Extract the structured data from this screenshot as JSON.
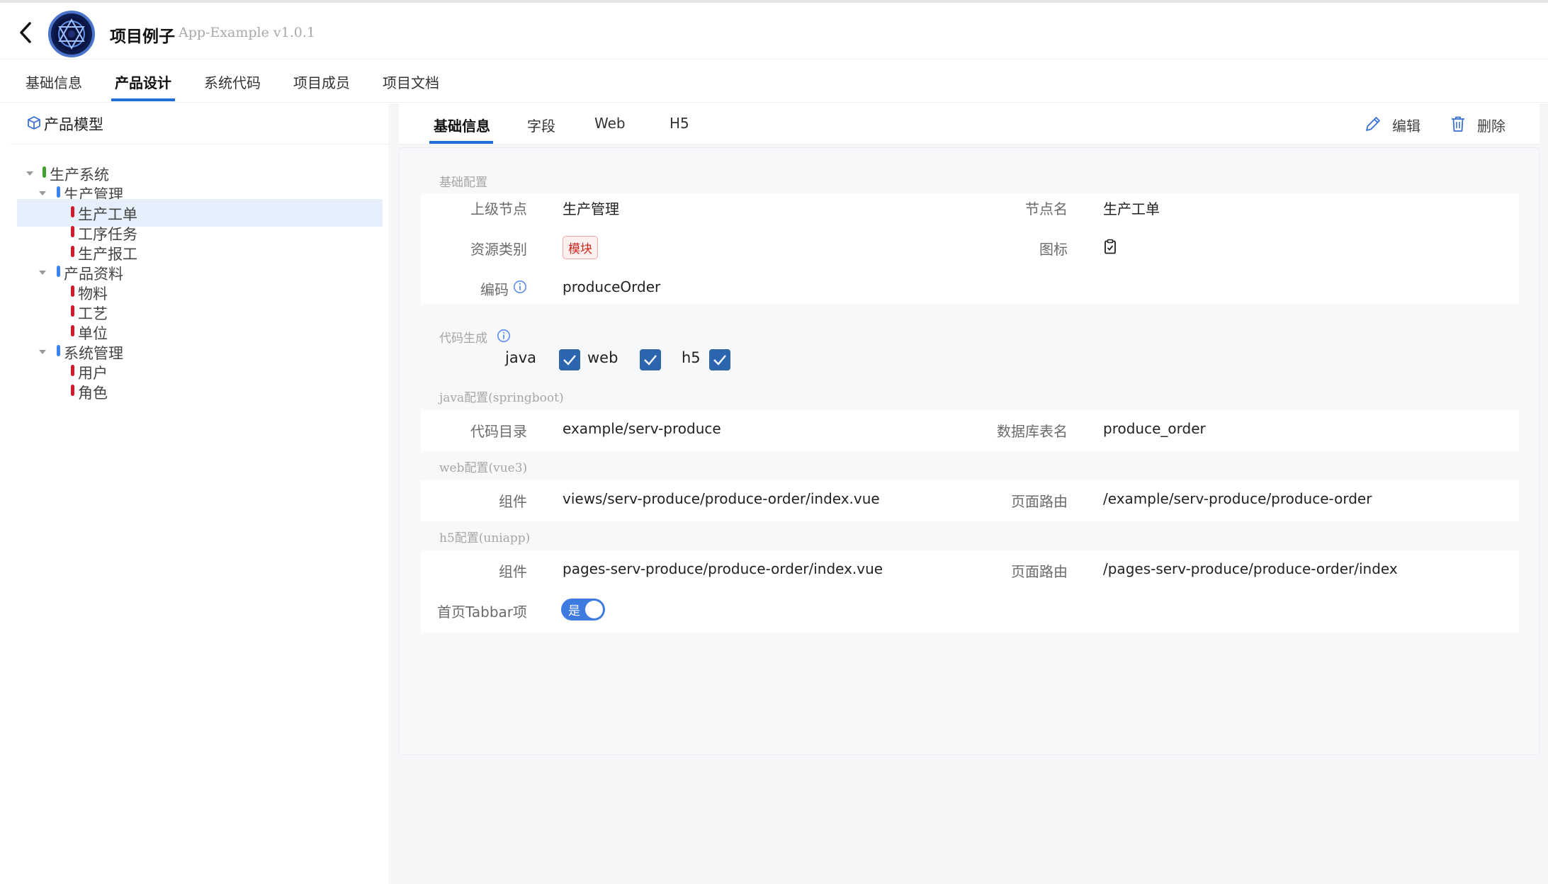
{
  "header": {
    "title": "项目例子",
    "version": "App-Example v1.0.1"
  },
  "top_tabs": [
    {
      "label": "基础信息"
    },
    {
      "label": "产品设计"
    },
    {
      "label": "系统代码"
    },
    {
      "label": "项目成员"
    },
    {
      "label": "项目文档"
    }
  ],
  "sidebar": {
    "title": "产品模型",
    "tree": [
      {
        "label": "生产系统",
        "level": 0,
        "expanded": true,
        "color": "#3fa22c"
      },
      {
        "label": "生产管理",
        "level": 1,
        "expanded": true,
        "color": "#3b82f6"
      },
      {
        "label": "生产工单",
        "level": 2,
        "selected": true,
        "color": "#d11a2a"
      },
      {
        "label": "工序任务",
        "level": 2,
        "color": "#d11a2a"
      },
      {
        "label": "生产报工",
        "level": 2,
        "color": "#d11a2a"
      },
      {
        "label": "产品资料",
        "level": 1,
        "expanded": true,
        "color": "#3b82f6"
      },
      {
        "label": "物料",
        "level": 2,
        "color": "#d11a2a"
      },
      {
        "label": "工艺",
        "level": 2,
        "color": "#d11a2a"
      },
      {
        "label": "单位",
        "level": 2,
        "color": "#d11a2a"
      },
      {
        "label": "系统管理",
        "level": 1,
        "expanded": true,
        "color": "#3b82f6"
      },
      {
        "label": "用户",
        "level": 2,
        "color": "#d11a2a"
      },
      {
        "label": "角色",
        "level": 2,
        "color": "#d11a2a"
      }
    ]
  },
  "detail": {
    "tabs": [
      {
        "label": "基础信息"
      },
      {
        "label": "字段"
      },
      {
        "label": "Web"
      },
      {
        "label": "H5"
      }
    ],
    "edit_label": "编辑",
    "delete_label": "删除",
    "basic": {
      "title": "基础配置",
      "parent_label": "上级节点",
      "parent_value": "生产管理",
      "node_label": "节点名",
      "node_value": "生产工单",
      "resource_label": "资源类别",
      "resource_value": "模块",
      "icon_label": "图标",
      "code_label": "编码",
      "code_value": "produceOrder"
    },
    "codegen": {
      "title": "代码生成",
      "options": [
        {
          "label": "java",
          "checked": true
        },
        {
          "label": "web",
          "checked": true
        },
        {
          "label": "h5",
          "checked": true
        }
      ]
    },
    "java": {
      "title": "java配置(springboot)",
      "dir_label": "代码目录",
      "dir_value": "example/serv-produce",
      "table_label": "数据库表名",
      "table_value": "produce_order"
    },
    "web": {
      "title": "web配置(vue3)",
      "component_label": "组件",
      "component_value": "views/serv-produce/produce-order/index.vue",
      "route_label": "页面路由",
      "route_value": "/example/serv-produce/produce-order"
    },
    "h5": {
      "title": "h5配置(uniapp)",
      "component_label": "组件",
      "component_value": "pages-serv-produce/produce-order/index.vue",
      "route_label": "页面路由",
      "route_value": "/pages-serv-produce/produce-order/index",
      "tabbar_label": "首页Tabbar项",
      "tabbar_value": "是",
      "tabbar_on": true
    }
  }
}
